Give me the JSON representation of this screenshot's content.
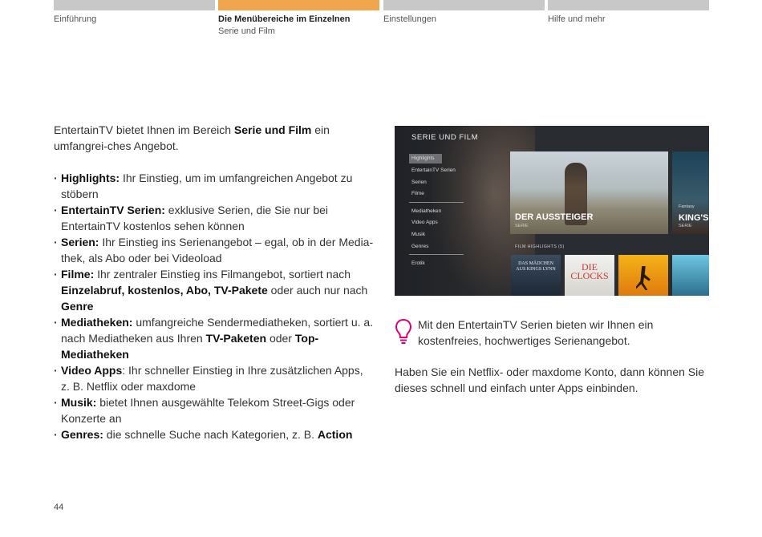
{
  "tabs": [
    {
      "title": "Einführung",
      "subtitle": ""
    },
    {
      "title": "Die Menübereiche im Einzelnen",
      "subtitle": "Serie und Film"
    },
    {
      "title": "Einstellungen",
      "subtitle": ""
    },
    {
      "title": "Hilfe und mehr",
      "subtitle": ""
    }
  ],
  "colors": {
    "active_tab": "#f0a64c",
    "inactive_tab": "#c8c8c8",
    "hint_icon": "#e20074"
  },
  "intro": {
    "before": "EntertainTV bietet Ihnen im Bereich ",
    "bold": "Serie und Film",
    "after": " ein umfangrei-ches Angebot."
  },
  "bullets": [
    {
      "label": "Highlights:",
      "text": " Ihr Einstieg, um im umfangreichen Angebot zu stöbern"
    },
    {
      "label": "EntertainTV Serien:",
      "text": " exklusive Serien, die Sie nur bei EntertainTV kostenlos sehen können"
    },
    {
      "label": "Serien:",
      "text": " Ihr Einstieg ins Serienangebot – egal, ob in der Media-thek, als Abo oder bei Videoload"
    },
    {
      "label": "Filme:",
      "text": " Ihr zentraler Einstieg ins Filmangebot, sortiert nach ",
      "b2": "Einzelabruf, kostenlos, Abo, TV-Pakete",
      "t2": " oder auch nur nach ",
      "b3": "Genre"
    },
    {
      "label": "Mediatheken:",
      "text": " umfangreiche Sendermediatheken, sortiert u. a. nach Mediatheken aus Ihren ",
      "b2": "TV-Paketen",
      "t2": " oder ",
      "b3": "Top-Mediatheken"
    },
    {
      "label": "Video Apps",
      "text": ": Ihr schneller Einstieg in Ihre zusätzlichen Apps, z. B. Netflix oder maxdome"
    },
    {
      "label": "Musik:",
      "text": " bietet Ihnen ausgewählte Telekom Street-Gigs oder Konzerte an"
    },
    {
      "label": "Genres:",
      "text": " die schnelle Suche nach Kategorien, z. B. ",
      "b2": "Action"
    }
  ],
  "tv": {
    "header": "SERIE UND FILM",
    "menu_group1": [
      "Highlights",
      "EntertainTV Serien",
      "Serien",
      "Filme"
    ],
    "menu_group2": [
      "Mediatheken",
      "Video Apps",
      "Musik",
      "Genres"
    ],
    "menu_group3": [
      "Erotik"
    ],
    "hero_title": "DER AUSSTEIGER",
    "hero_sub": "SERIE",
    "side_title": "KING'S",
    "side_sub": "SERIE",
    "side_flag": "Fantasy",
    "row_label": "FILM HIGHLIGHTS (5)",
    "poster1": "DAS MÄDCHEN AUS KINGS LYNN",
    "poster2": "DIE CLOCKS"
  },
  "hint": "Mit den EntertainTV Serien bieten wir Ihnen ein kostenfreies, hochwertiges Serienangebot.",
  "note": "Haben Sie ein Netflix- oder maxdome Konto, dann können Sie dieses schnell und einfach unter Apps einbinden.",
  "page_number": "44"
}
